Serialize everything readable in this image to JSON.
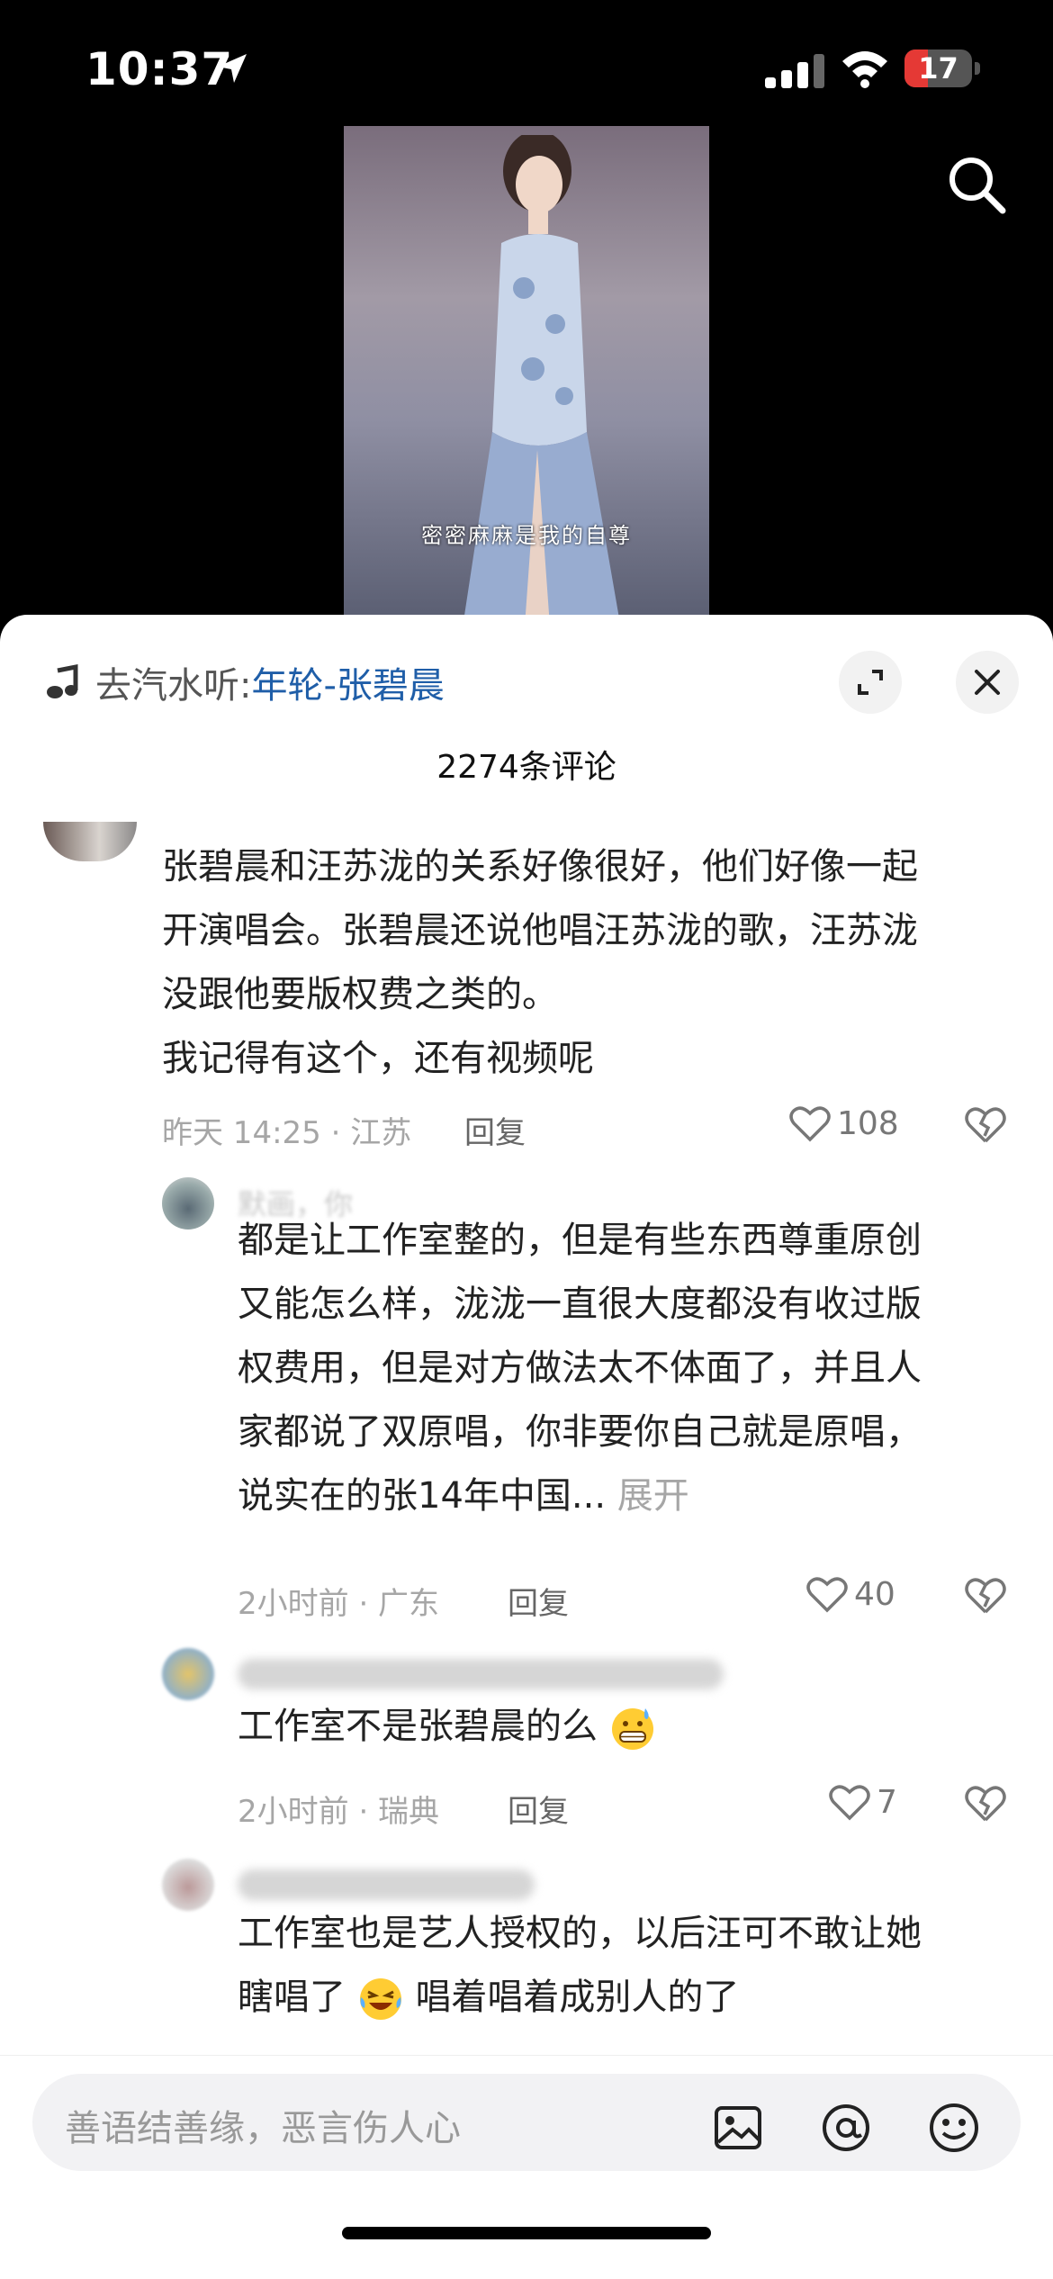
{
  "status": {
    "time": "10:37",
    "battery": "17"
  },
  "video": {
    "subtitle": "密密麻麻是我的自尊"
  },
  "music": {
    "prefix": "去汽水听:",
    "song": "年轮-张碧晨"
  },
  "comments_count": "2274条评论",
  "comments": [
    {
      "lines": [
        "张碧晨和汪苏泷的关系好像很好，他们好像一起",
        "开演唱会。张碧晨还说他唱汪苏泷的歌，汪苏泷",
        "没跟他要版权费之类的。",
        "我记得有这个，还有视频呢"
      ],
      "time": "昨天 14:25 · 江苏",
      "reply": "回复",
      "likes": "108"
    },
    {
      "name": "默画，你",
      "lines": [
        "都是让工作室整的，但是有些东西尊重原创",
        "又能怎么样，泷泷一直很大度都没有收过版",
        "权费用，但是对方做法太不体面了，并且人",
        "家都说了双原唱，你非要你自己就是原唱，"
      ],
      "last_line": "说实在的张14年中国...",
      "expand": "展开",
      "time": "2小时前 · 广东",
      "reply": "回复",
      "likes": "40"
    },
    {
      "text": "工作室不是张碧晨的么",
      "emoji": "grimacing-sweat-emoji",
      "time": "2小时前 · 瑞典",
      "reply": "回复",
      "likes": "7"
    },
    {
      "line1": "工作室也是艺人授权的，以后汪可不敢让她",
      "line2_a": "瞎唱了",
      "line2_b": "唱着唱着成别人的了",
      "emoji": "rolling-laughing-emoji"
    }
  ],
  "input": {
    "placeholder": "善语结善缘，恶言伤人心"
  },
  "icons": {
    "image": "image-icon",
    "at": "at-icon",
    "emoji": "emoji-icon"
  },
  "colors": {
    "link": "#1f5ea8",
    "battery_low": "#e53935"
  }
}
